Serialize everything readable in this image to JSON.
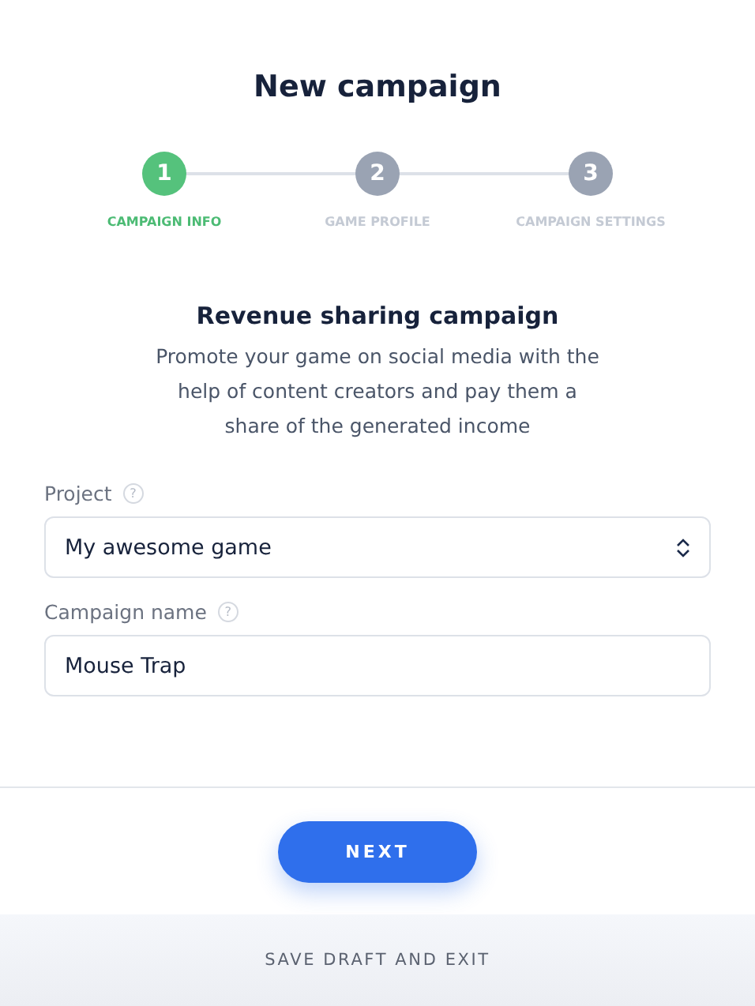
{
  "title": "New campaign",
  "steps": [
    {
      "number": "1",
      "label": "CAMPAIGN INFO",
      "selected": true
    },
    {
      "number": "2",
      "label": "GAME PROFILE",
      "selected": false
    },
    {
      "number": "3",
      "label": "CAMPAIGN SETTINGS",
      "selected": false
    }
  ],
  "section": {
    "heading": "Revenue sharing campaign",
    "description": "Promote your game on social media with the help of content creators and pay them a share of the generated income"
  },
  "fields": [
    {
      "kind": "select",
      "label": "Project",
      "help": "?",
      "value": "My awesome game"
    },
    {
      "kind": "text",
      "label": "Campaign name",
      "help": "?",
      "value": "Mouse Trap"
    }
  ],
  "next_button": "NEXT",
  "save_link": "SAVE DRAFT AND EXIT"
}
